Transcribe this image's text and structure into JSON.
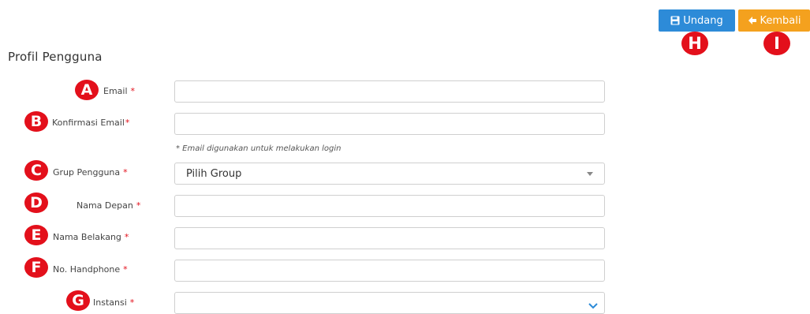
{
  "toolbar": {
    "invite_label": "Undang",
    "back_label": "Kembali"
  },
  "page": {
    "title": "Profil Pengguna"
  },
  "form": {
    "required_mark": "*",
    "email_label": "Email",
    "confirm_email_label": "Konfirmasi Email",
    "email_hint": "* Email digunakan untuk melakukan login",
    "group_label": "Grup Pengguna",
    "group_selected": "Pilih Group",
    "first_name_label": "Nama Depan",
    "last_name_label": "Nama Belakang",
    "phone_label": "No. Handphone",
    "agency_label": "Instansi"
  },
  "markers": {
    "a": "A",
    "b": "B",
    "c": "C",
    "d": "D",
    "e": "E",
    "f": "F",
    "g": "G",
    "h": "H",
    "i": "I"
  },
  "colors": {
    "primary_button": "#2d8bd8",
    "warning_button": "#f4a11e",
    "marker_red": "#e3101b"
  },
  "icons": {
    "invite": "save-icon",
    "back": "arrow-left-icon",
    "group_dropdown": "caret-down-icon",
    "agency_dropdown": "chevron-down-icon"
  }
}
